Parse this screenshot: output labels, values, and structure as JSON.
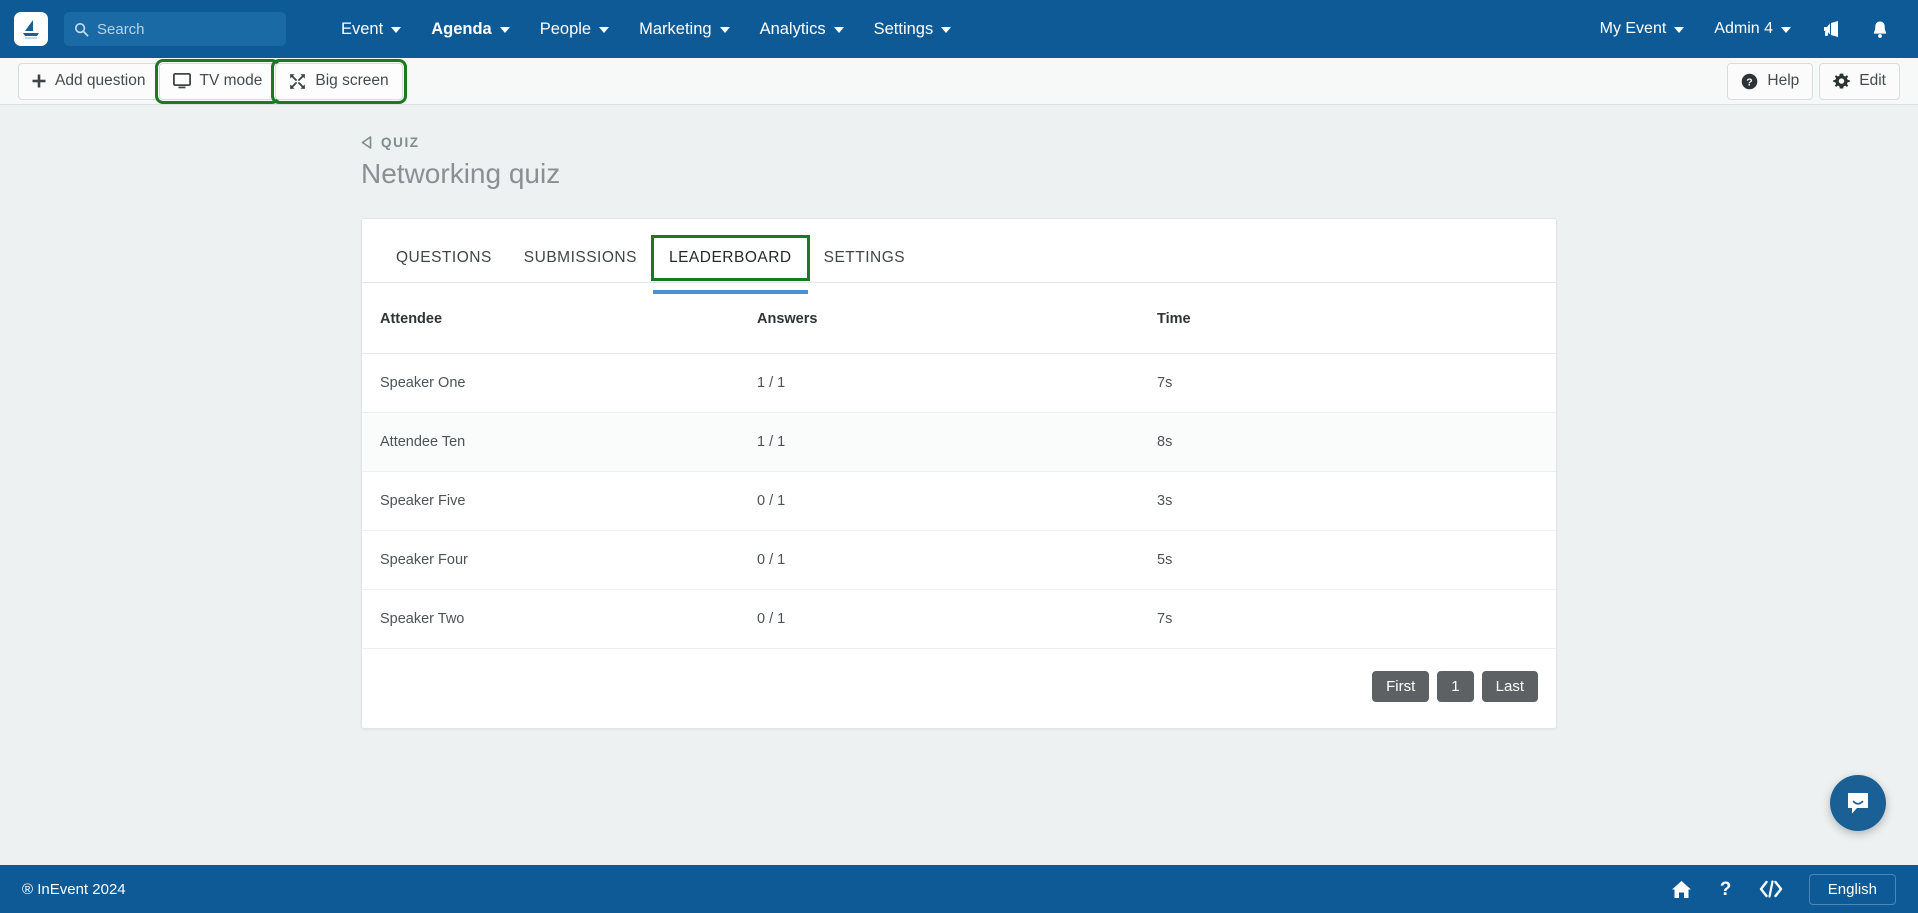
{
  "topnav": {
    "logo_name": "inevent-logo",
    "search": {
      "placeholder": "Search",
      "value": ""
    },
    "items": [
      {
        "label": "Event",
        "has_caret": true,
        "active": false
      },
      {
        "label": "Agenda",
        "has_caret": true,
        "active": true
      },
      {
        "label": "People",
        "has_caret": true,
        "active": false
      },
      {
        "label": "Marketing",
        "has_caret": true,
        "active": false
      },
      {
        "label": "Analytics",
        "has_caret": true,
        "active": false
      },
      {
        "label": "Settings",
        "has_caret": true,
        "active": false
      }
    ],
    "right": {
      "event_label": "My Event",
      "admin_label": "Admin 4",
      "megaphone_icon": "megaphone-icon",
      "bell_icon": "bell-icon"
    },
    "bg_color": "#0e5a96"
  },
  "toolbar": {
    "add_question_label": "Add question",
    "tv_mode_label": "TV mode",
    "big_screen_label": "Big screen",
    "help_label": "Help",
    "edit_label": "Edit",
    "highlight_color": "#1a7a22"
  },
  "main": {
    "breadcrumb_label": "QUIZ",
    "page_title": "Networking quiz",
    "tabs": [
      {
        "label": "QUESTIONS",
        "active": false,
        "highlighted": false
      },
      {
        "label": "SUBMISSIONS",
        "active": false,
        "highlighted": false
      },
      {
        "label": "LEADERBOARD",
        "active": true,
        "highlighted": true
      },
      {
        "label": "SETTINGS",
        "active": false,
        "highlighted": false
      }
    ],
    "table": {
      "columns": [
        "Attendee",
        "Answers",
        "Time"
      ],
      "rows": [
        {
          "attendee": "Speaker One",
          "answers": "1 / 1",
          "time": "7s"
        },
        {
          "attendee": "Attendee Ten",
          "answers": "1 / 1",
          "time": "8s"
        },
        {
          "attendee": "Speaker Five",
          "answers": "0 / 1",
          "time": "3s"
        },
        {
          "attendee": "Speaker Four",
          "answers": "0 / 1",
          "time": "5s"
        },
        {
          "attendee": "Speaker Two",
          "answers": "0 / 1",
          "time": "7s"
        }
      ]
    },
    "pagination": {
      "first_label": "First",
      "current_page": "1",
      "last_label": "Last"
    },
    "active_tab_underline_color": "#4a90d9"
  },
  "chat": {
    "icon": "chat-bubble-icon",
    "color": "#1a6095"
  },
  "footer": {
    "copyright": "® InEvent 2024",
    "home_icon": "home-icon",
    "help_icon": "question-mark-icon",
    "code_icon": "code-icon",
    "language_label": "English"
  }
}
